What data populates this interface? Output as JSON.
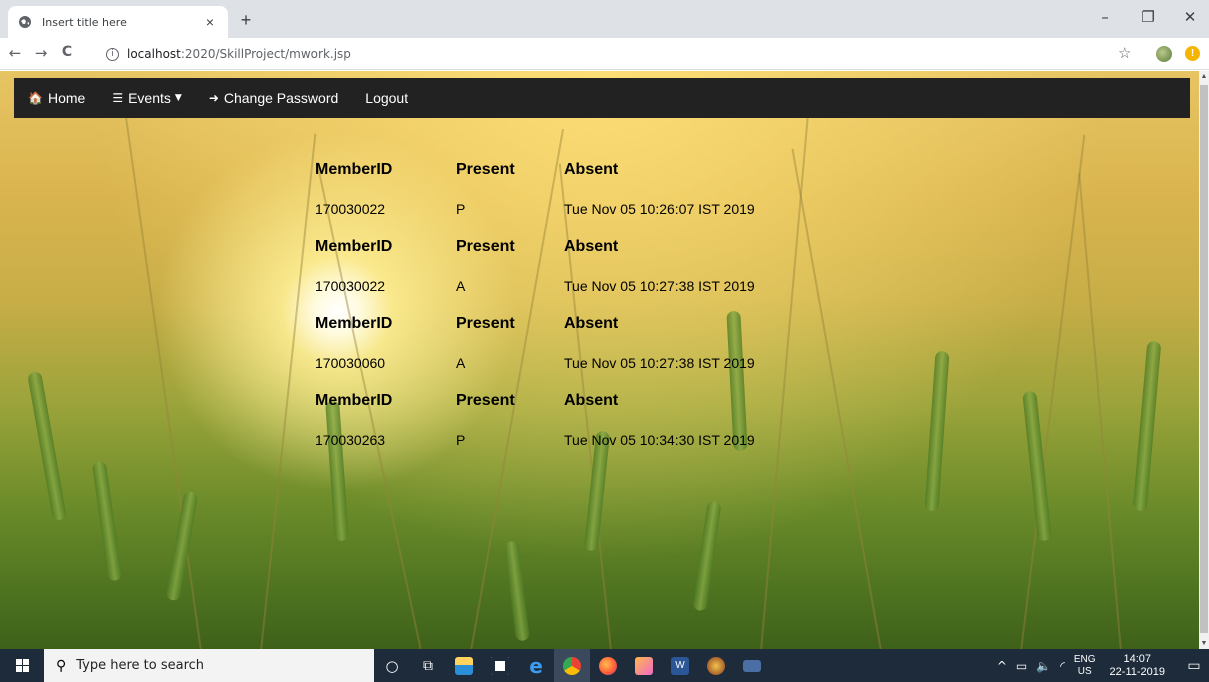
{
  "browser": {
    "tab": {
      "title": "Insert title here",
      "close": "×"
    },
    "new_tab": "+",
    "window": {
      "minimize": "–",
      "restore": "❐",
      "close": "✕"
    },
    "nav": {
      "back": "←",
      "forward": "→",
      "reload": "C"
    },
    "url": {
      "host": "localhost",
      "path": ":2020/SkillProject/mwork.jsp"
    },
    "star": "☆"
  },
  "navbar": {
    "items": [
      {
        "label": "Home",
        "icon": "home-icon",
        "glyph": "🏠"
      },
      {
        "label": "Events",
        "icon": "calendar-list-icon",
        "glyph": "☰",
        "dropdown": true
      },
      {
        "label": "Change Password",
        "icon": "sign-in-icon",
        "glyph": "➜"
      },
      {
        "label": "Logout"
      }
    ]
  },
  "records": [
    {
      "headers": [
        "MemberID",
        "Present",
        "Absent"
      ],
      "values": [
        "170030022",
        "P",
        "Tue Nov 05 10:26:07 IST 2019"
      ]
    },
    {
      "headers": [
        "MemberID",
        "Present",
        "Absent"
      ],
      "values": [
        "170030022",
        "A",
        "Tue Nov 05 10:27:38 IST 2019"
      ]
    },
    {
      "headers": [
        "MemberID",
        "Present",
        "Absent"
      ],
      "values": [
        "170030060",
        "A",
        "Tue Nov 05 10:27:38 IST 2019"
      ]
    },
    {
      "headers": [
        "MemberID",
        "Present",
        "Absent"
      ],
      "values": [
        "170030263",
        "P",
        "Tue Nov 05 10:34:30 IST 2019"
      ]
    }
  ],
  "taskbar": {
    "search_placeholder": "Type here to search",
    "apps": [
      "cortana-icon",
      "task-view-icon",
      "file-explorer-icon",
      "store-icon",
      "edge-icon",
      "chrome-icon",
      "firefox-icon",
      "app-icon",
      "word-icon",
      "game-icon",
      "window-app-icon"
    ],
    "tray": {
      "lang_top": "ENG",
      "lang_bottom": "US",
      "time": "14:07",
      "date": "22-11-2019"
    }
  },
  "colors": {
    "navbar": "#222222",
    "taskbar": "#1d2b3a",
    "accent_sun": "#fff6c0"
  }
}
